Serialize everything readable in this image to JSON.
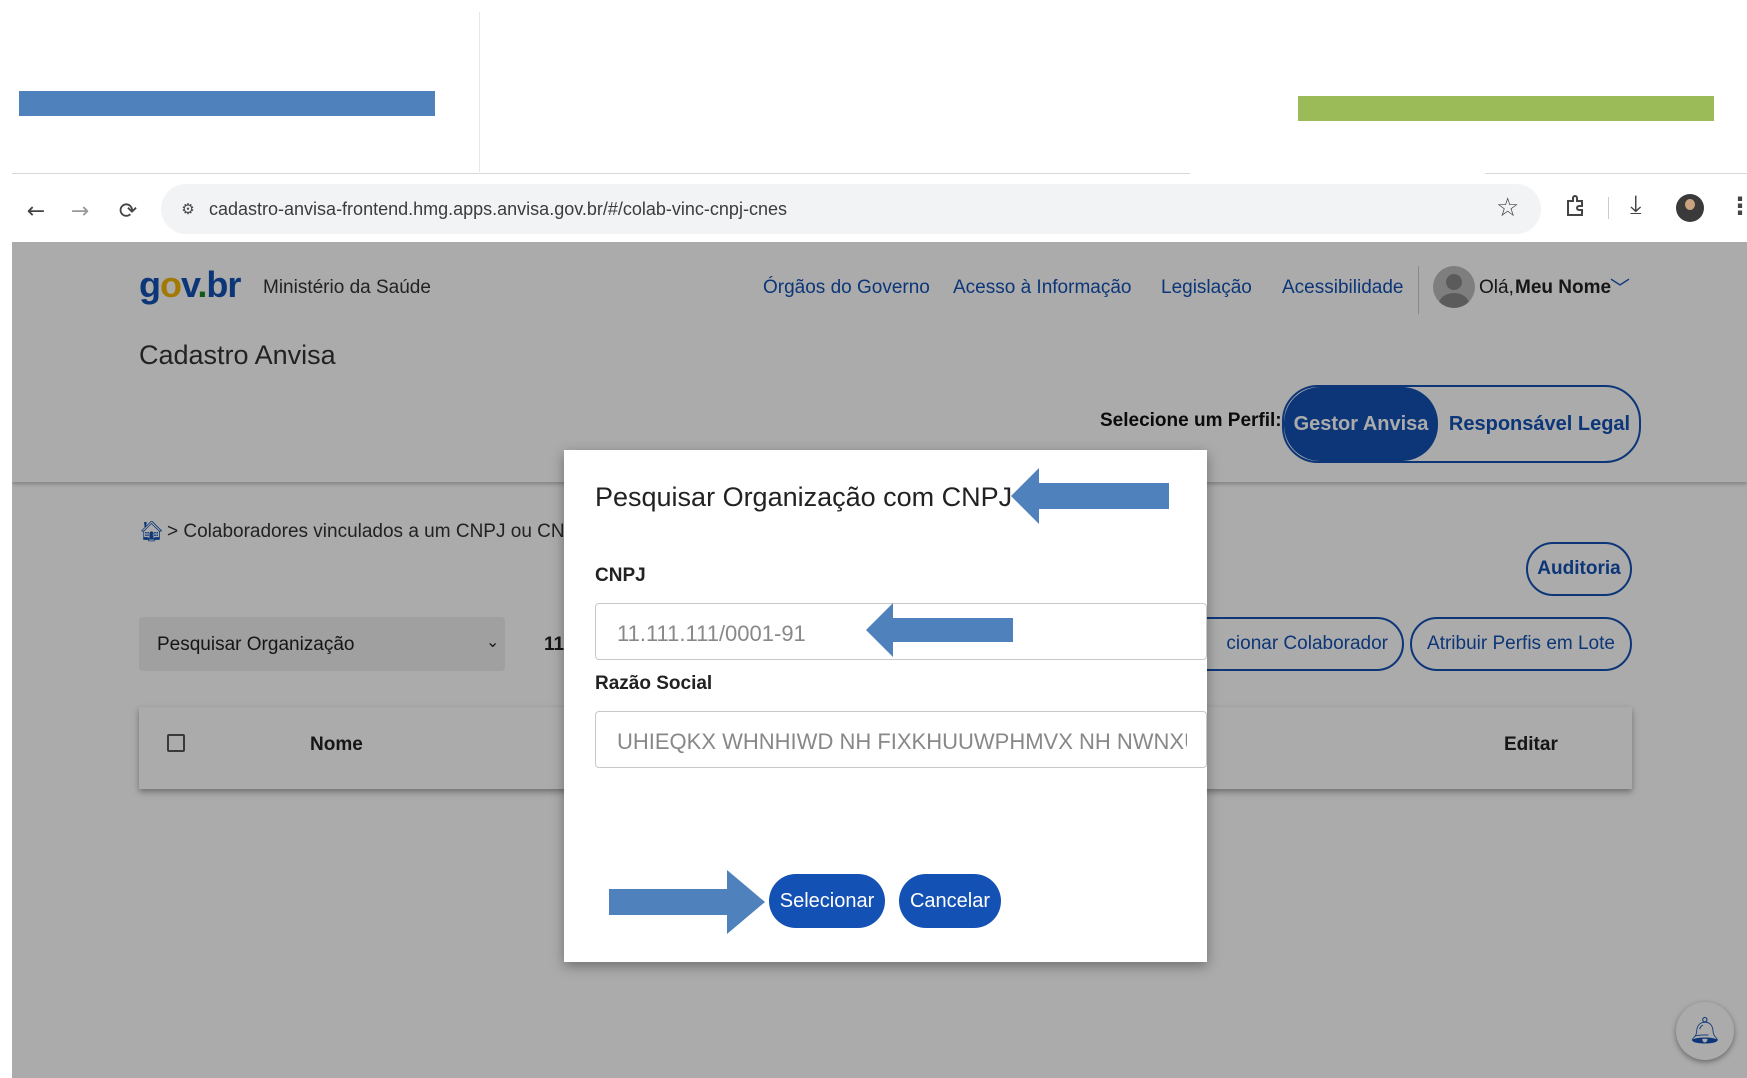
{
  "browser": {
    "url": "cadastro-anvisa-frontend.hmg.apps.anvisa.gov.br/#/colab-vinc-cnpj-cnes"
  },
  "header": {
    "logo": {
      "g": "g",
      "o": "o",
      "v": "v",
      "dot": ".",
      "b": "br"
    },
    "ministry": "Ministério da Saúde",
    "links": [
      "Órgãos do Governo",
      "Acesso à Informação",
      "Legislação",
      "Acessibilidade"
    ],
    "greeting": "Olá,",
    "user_name": "Meu Nome",
    "system_title": "Cadastro Anvisa",
    "profile_label": "Selecione um Perfil:",
    "profiles": [
      "Gestor Anvisa",
      "Responsável Legal"
    ],
    "active_profile": "Gestor Anvisa"
  },
  "main": {
    "breadcrumb": "> Colaboradores vinculados a um CNPJ ou CNE",
    "auditoria_label": "Auditoria",
    "search_select": "Pesquisar Organização",
    "field_partial": "11",
    "add_collaborator_label": "cionar Colaborador",
    "assign_profiles_label": "Atribuir Perfis em Lote",
    "table_headers": {
      "name": "Nome",
      "edit": "Editar"
    }
  },
  "modal": {
    "title": "Pesquisar Organização com CNPJ",
    "cnpj_label": "CNPJ",
    "cnpj_placeholder": "11.111.111/0001-91",
    "razao_label": "Razão Social",
    "razao_placeholder": "UHIEQKX WHNHIWD NH FIXKHUUWPHMVX NH NWNXU",
    "select_label": "Selecionar",
    "cancel_label": "Cancelar"
  },
  "colors": {
    "accent": "#1351b4",
    "annotation_arrow": "#4f81bd",
    "annotation_bar_blue": "#4f81bd",
    "annotation_bar_green": "#9bbb59"
  }
}
